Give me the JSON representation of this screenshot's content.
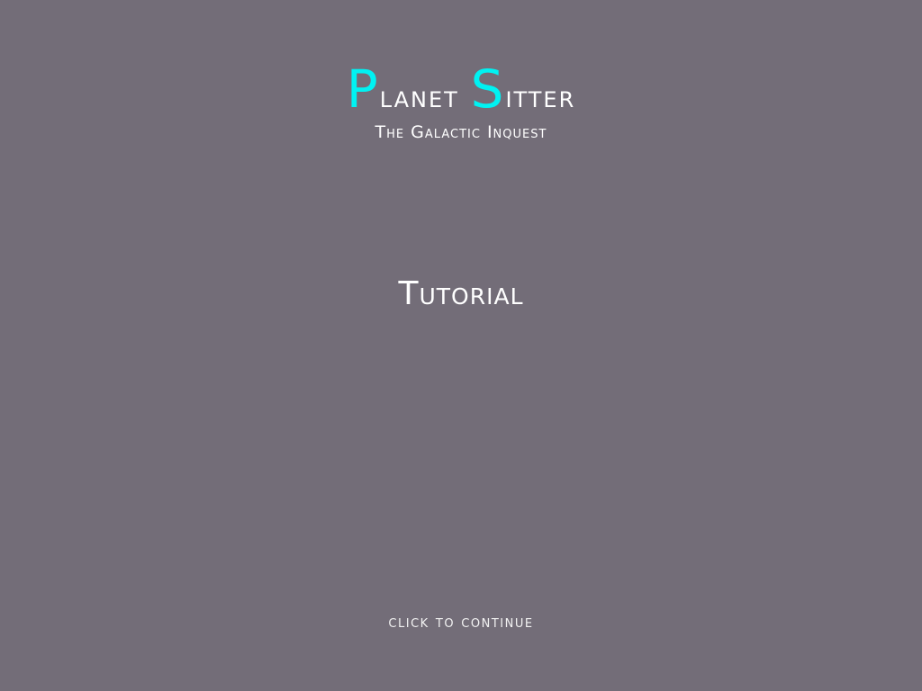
{
  "title": {
    "part1_initial": "P",
    "part1_rest": "lanet",
    "part2_initial": "S",
    "part2_rest": "itter",
    "accent_color": "#00f2f2"
  },
  "subtitle": "The Galactic Inquest",
  "section_heading": "Tutorial",
  "continue_hint": "click to continue",
  "colors": {
    "background": "#736d78",
    "text": "#ffffff"
  }
}
